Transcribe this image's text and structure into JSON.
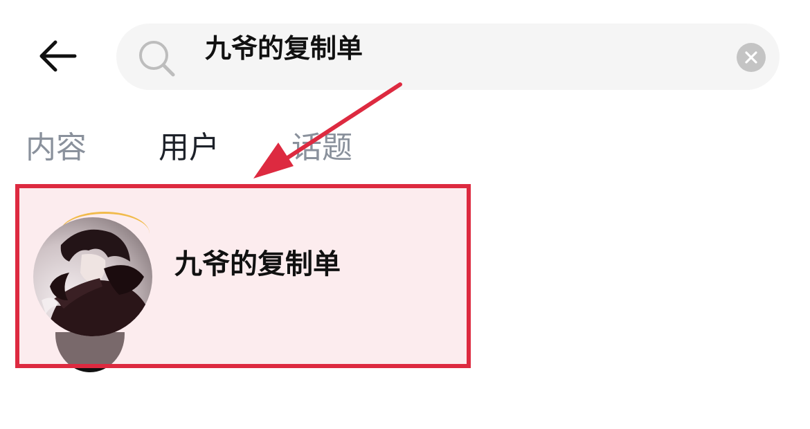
{
  "header": {
    "back_icon": "arrow-left-icon",
    "search": {
      "value": "九爷的复制单",
      "search_icon": "search-icon",
      "clear_icon": "close-circle-icon"
    }
  },
  "tabs": [
    {
      "label": "内容",
      "active": false
    },
    {
      "label": "用户",
      "active": true
    },
    {
      "label": "话题",
      "active": false
    }
  ],
  "results": [
    {
      "name": "九爷的复制单",
      "avatar": "anime-character-avatar",
      "highlighted": true
    }
  ],
  "colors": {
    "highlight_border": "#dd2a40",
    "highlight_fill": "#fdebee",
    "search_bg": "#f5f5f5",
    "tab_inactive": "#8a919c",
    "tab_active": "#1d2129"
  }
}
